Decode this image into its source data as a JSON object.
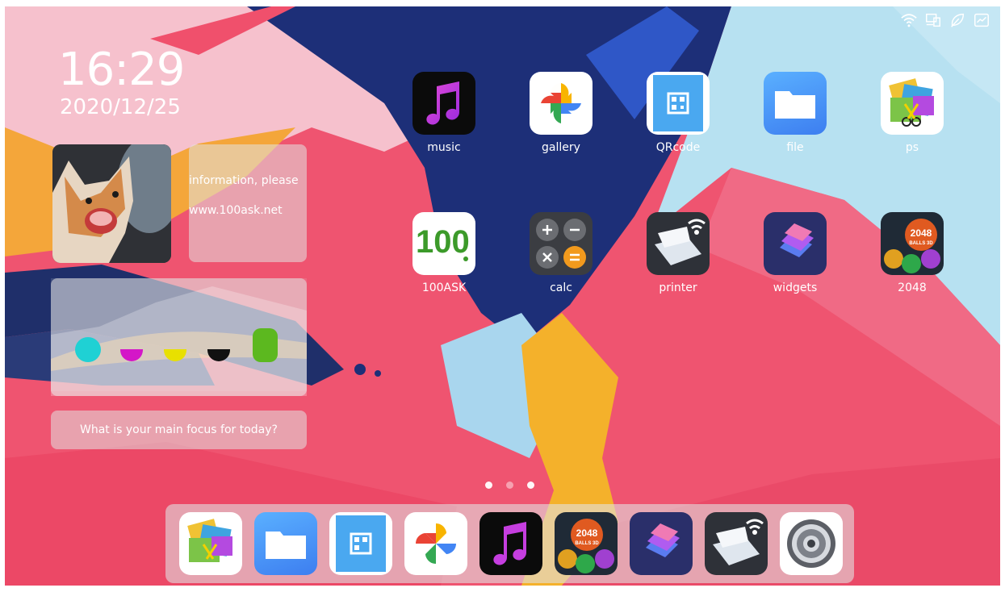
{
  "status_icons": [
    "wifi-icon",
    "devices-icon",
    "eco-icon",
    "chart-icon"
  ],
  "clock": {
    "time": "16:29",
    "date": "2020/12/25"
  },
  "info_widget": {
    "line1": "information, please",
    "line2": "www.100ask.net"
  },
  "color_widget": {
    "colors": [
      "#1fd1d4",
      "#d416c8",
      "#e8e000",
      "#111111",
      "#5cb81f"
    ]
  },
  "focus_widget": {
    "text": "What is your main focus for today?"
  },
  "apps": [
    {
      "label": "music",
      "icon": "music-icon"
    },
    {
      "label": "gallery",
      "icon": "pinwheel-icon"
    },
    {
      "label": "QRcode",
      "icon": "qrcode-icon"
    },
    {
      "label": "file",
      "icon": "folder-icon"
    },
    {
      "label": "ps",
      "icon": "photo-editor-icon"
    },
    {
      "label": "100ASK",
      "icon": "100ask-logo-icon"
    },
    {
      "label": "calc",
      "icon": "calculator-icon"
    },
    {
      "label": "printer",
      "icon": "printer-icon"
    },
    {
      "label": "widgets",
      "icon": "widgets-icon"
    },
    {
      "label": "2048",
      "icon": "2048-game-icon"
    }
  ],
  "game_icon_text": {
    "line1": "2048",
    "line2": "BALLS 3D"
  },
  "page_indicator": {
    "count": 3,
    "active_index": 0
  },
  "dock": [
    "photo-editor-icon",
    "folder-icon",
    "qrcode-icon",
    "pinwheel-icon",
    "music-icon",
    "2048-game-icon",
    "widgets-icon",
    "printer-icon",
    "settings-icon"
  ],
  "colors": {
    "wallpaper_pink": "#ee4f6b",
    "wallpaper_blue": "#b6e0ef",
    "wallpaper_navy": "#1e3a7a",
    "wallpaper_yellow": "#f3b52b"
  }
}
